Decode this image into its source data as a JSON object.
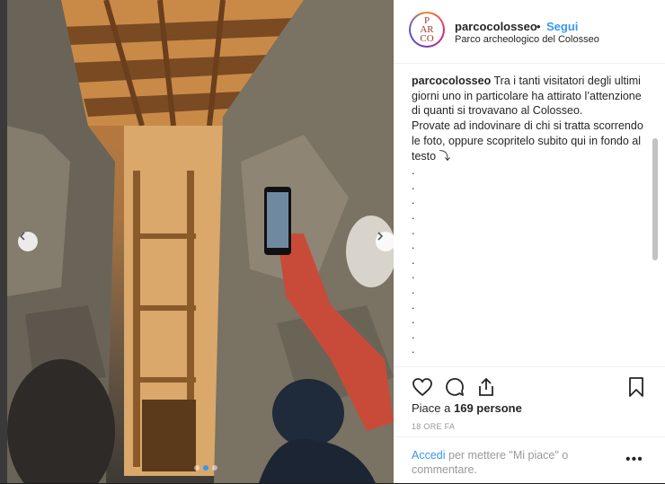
{
  "post": {
    "username": "parcocolosseo",
    "follow_separator": "•",
    "follow_label": "Segui",
    "location": "Parco archeologico del Colosseo",
    "avatar_text_1": "P",
    "avatar_text_2": "AR",
    "avatar_text_3": "CO",
    "caption": {
      "username": "parcocolosseo",
      "text": "Tra i tanti visitatori degli ultimi giorni uno in particolare ha attirato l’attenzione di quanti si trovavano al Colosseo.",
      "text2": "Provate ad indovinare di chi si tratta scorrendo le foto, oppure scopritelo subito qui in fondo al testo ⤵",
      "dots": [
        ".",
        ".",
        ".",
        ".",
        ".",
        ".",
        ".",
        ".",
        ".",
        ".",
        ".",
        ".",
        "."
      ]
    },
    "likes_prefix": "Piace a ",
    "likes_count": "169 persone",
    "time": "18 ORE FA",
    "login_link": "Accedi",
    "login_text": " per mettere \"Mi piace\" o commentare.",
    "more_label": "•••"
  },
  "icons": {
    "like": "heart-icon",
    "comment": "comment-icon",
    "share": "share-icon",
    "save": "bookmark-icon",
    "prev": "chevron-left-icon",
    "next": "chevron-right-icon"
  },
  "colors": {
    "accent": "#3897f0",
    "text": "#262626",
    "muted": "#999999"
  }
}
